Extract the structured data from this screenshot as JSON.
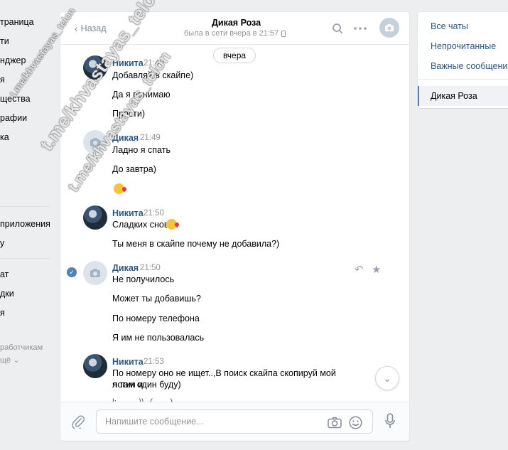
{
  "left_nav": {
    "items": [
      "траница",
      "ти",
      "нджер",
      "я",
      "щества",
      "рафии",
      "ка",
      "",
      "",
      "приложения",
      "у",
      "ат",
      "дки",
      "я"
    ],
    "footer_text": "работчикам",
    "more_label": "щё"
  },
  "header": {
    "back_label": "Назад",
    "peer_name": "Дикая Роза",
    "peer_status": "была в сети вчера в 21:57",
    "search_icon": "search-icon",
    "more_icon": "more-dots-icon"
  },
  "date_divider": "вчера",
  "messages": [
    {
      "author": "Никита",
      "time": "21:49",
      "lines": [
        "Добавляй в скайпе)",
        "Да я понимаю",
        "Прости)"
      ]
    },
    {
      "author": "Дикая",
      "time": "21:49",
      "lines": [
        "Ладно я спать",
        "До завтра)"
      ]
    },
    {
      "author": "Никита",
      "time": "21:50",
      "lines": [
        "Сладких снов",
        "Ты меня в скайпе почему не добавила?)"
      ]
    },
    {
      "author": "Дикая",
      "time": "21:50",
      "lines": [
        "Не получилось",
        "Может ты добавишь?",
        "По номеру телефона",
        "Я им не пользовалась"
      ]
    },
    {
      "author": "Никита",
      "time": "21:53",
      "lines": [
        "По номеру оно не ищет..,В поиск скайпа скопируй мой логин и",
        "я там один буду)",
        "l:··· ·· ·\\\\ ·(··· ··) ·· · ··"
      ]
    }
  ],
  "composer": {
    "placeholder": "Напишите сообщение..."
  },
  "right_panel": {
    "items": [
      "Все чаты",
      "Непрочитанные",
      "Важные сообщения"
    ],
    "active_chat": "Дикая Роза"
  },
  "watermark": {
    "lines": [
      "t.me/khvastayas_telon",
      "t.me/khvastayas_telon",
      "t.me/khvastayas_telon"
    ]
  },
  "colors": {
    "accent": "#5181b8",
    "author": "#2a5885",
    "muted": "#939393",
    "background": "#edeef0"
  }
}
